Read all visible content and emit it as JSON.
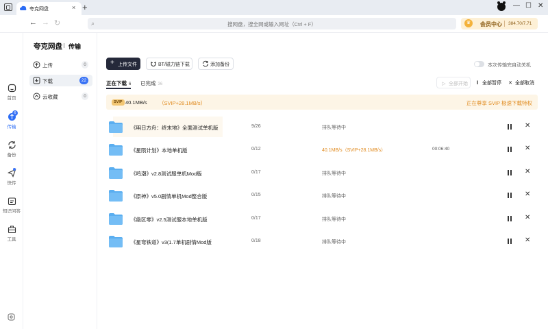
{
  "browser": {
    "tab_title": "夸克网盘",
    "tab_close": "×",
    "new_tab": "+",
    "address_placeholder": "搜网盘，搜全网或输入网址（Ctrl + F）",
    "vip_label": "会员中心",
    "vip_store": "384.70/7.71",
    "win_min": "—",
    "win_max": "☐",
    "win_close": "✕"
  },
  "rail": {
    "items": [
      {
        "label": "首页",
        "icon": "home-icon"
      },
      {
        "label": "传输",
        "icon": "transfer-icon",
        "badge": "6"
      },
      {
        "label": "备份",
        "icon": "backup-icon"
      },
      {
        "label": "快传",
        "icon": "quick-send-icon"
      },
      {
        "label": "知识问答",
        "icon": "qa-icon"
      },
      {
        "label": "工具",
        "icon": "toolbox-icon"
      }
    ]
  },
  "sidebar": {
    "brand": "夸克网盘",
    "section": "传输",
    "items": [
      {
        "label": "上传",
        "count": "0"
      },
      {
        "label": "下载",
        "count": "22"
      },
      {
        "label": "云收藏",
        "count": "0"
      }
    ]
  },
  "toolbar": {
    "upload_label": "上传文件",
    "bt_label": "BT/磁力链下载",
    "backup_label": "添加备份",
    "auto_shutdown_label": "本次传输完自动关机",
    "auto_shutdown_on": false
  },
  "tabs": {
    "downloading_label": "正在下载",
    "downloading_count": "6",
    "done_label": "已完成",
    "done_count": "36"
  },
  "actions": {
    "start_all": "全部开始",
    "pause_all": "全部暂停",
    "cancel_all": "全部取消"
  },
  "speed": {
    "tag": "SVIP",
    "main": "40.1MB/s",
    "extra": "（SVIP+28.1MB/s）",
    "promo": "正在尊享 SVIP 极速下载特权"
  },
  "files": [
    {
      "name": "《明日方舟：终末地》全面测试单机版",
      "progress": "9/26",
      "status": "排队等待中",
      "time": ""
    },
    {
      "name": "《星陨计划》本地单机版",
      "progress": "0/12",
      "status": "40.1MB/s（SVIP+28.1MB/s）",
      "time": "00:06:40"
    },
    {
      "name": "《鸣潮》v2.8测试服单机Mod版",
      "progress": "0/17",
      "status": "排队等待中",
      "time": ""
    },
    {
      "name": "《原神》v5.0剧情单机Mod整合版",
      "progress": "0/15",
      "status": "排队等待中",
      "time": ""
    },
    {
      "name": "《绝区零》v2.5测试服本地单机版",
      "progress": "0/17",
      "status": "排队等待中",
      "time": ""
    },
    {
      "name": "《星穹铁道》v3(1.7单机剧情Mod版",
      "progress": "0/18",
      "status": "排队等待中",
      "time": ""
    }
  ],
  "colors": {
    "accent": "#3a73f5",
    "primary_button": "#25293a",
    "orange": "#e08a1e",
    "folder": "#5aaef0"
  }
}
